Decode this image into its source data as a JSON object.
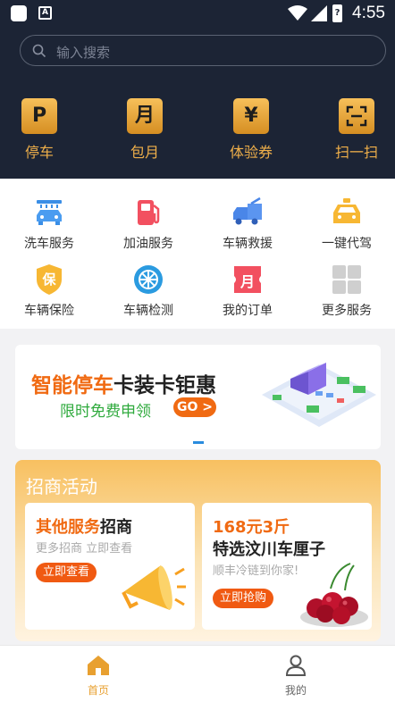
{
  "status_bar": {
    "time": "4:55",
    "battery_glyph": "?"
  },
  "search": {
    "placeholder": "输入搜索"
  },
  "quick_actions": [
    {
      "glyph": "P",
      "label": "停车",
      "icon": "parking-icon"
    },
    {
      "glyph": "月",
      "label": "包月",
      "icon": "monthly-pass-icon"
    },
    {
      "glyph": "¥",
      "label": "体验券",
      "icon": "coupon-icon"
    },
    {
      "glyph": "",
      "label": "扫一扫",
      "icon": "scan-icon"
    }
  ],
  "services": [
    {
      "label": "洗车服务",
      "icon": "car-wash-icon"
    },
    {
      "label": "加油服务",
      "icon": "fuel-pump-icon"
    },
    {
      "label": "车辆救援",
      "icon": "tow-truck-icon"
    },
    {
      "label": "一键代驾",
      "icon": "designated-driver-icon"
    },
    {
      "label": "车辆保险",
      "icon": "insurance-shield-icon"
    },
    {
      "label": "车辆检测",
      "icon": "wheel-inspection-icon"
    },
    {
      "label": "我的订单",
      "icon": "orders-icon"
    },
    {
      "label": "更多服务",
      "icon": "more-grid-icon"
    }
  ],
  "banner": {
    "title_highlight": "智能停车",
    "title_rest": "卡装卡钜惠",
    "subtitle": "限时免费申领",
    "go_label": "GO",
    "go_glyph": ">"
  },
  "promo": {
    "title": "招商活动",
    "card1": {
      "title_highlight": "其他服务",
      "title_rest": "招商",
      "subtitle": "更多招商 立即查看",
      "button": "立即查看"
    },
    "card2": {
      "title_highlight": "168元3斤",
      "title_line2": "特选汶川车厘子",
      "subtitle": "顺丰冷链到你家!",
      "button": "立即抢购"
    }
  },
  "service_shield_glyph": "保",
  "service_orders_glyph": "月",
  "tabbar": [
    {
      "label": "首页",
      "active": true,
      "icon": "home-icon"
    },
    {
      "label": "我的",
      "active": false,
      "icon": "profile-icon"
    }
  ],
  "colors": {
    "accent": "#f0b04a",
    "header_bg": "#1c2435",
    "orange": "#f06a12",
    "tab_active": "#e8a030"
  }
}
